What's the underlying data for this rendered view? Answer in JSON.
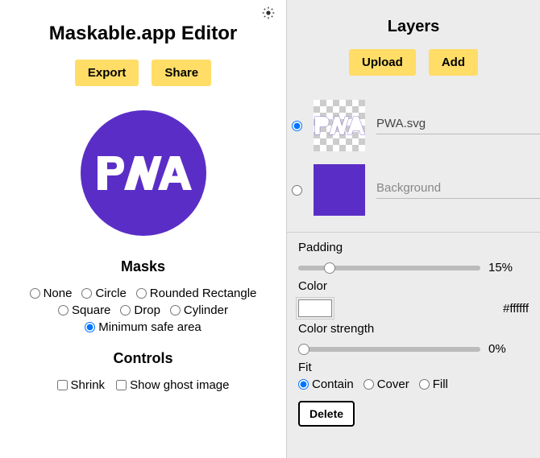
{
  "app_title": "Maskable.app Editor",
  "toolbar": {
    "export": "Export",
    "share": "Share"
  },
  "masks": {
    "heading": "Masks",
    "options": [
      "None",
      "Circle",
      "Rounded Rectangle",
      "Square",
      "Drop",
      "Cylinder",
      "Minimum safe area"
    ],
    "selected": "Minimum safe area"
  },
  "controls": {
    "heading": "Controls",
    "shrink": "Shrink",
    "ghost": "Show ghost image"
  },
  "layers_panel": {
    "heading": "Layers",
    "upload": "Upload",
    "add": "Add",
    "items": [
      {
        "name": "PWA.svg",
        "selected": true,
        "kind": "svg"
      },
      {
        "name": "Background",
        "selected": false,
        "kind": "solid"
      }
    ]
  },
  "props": {
    "padding_label": "Padding",
    "padding_value": "15%",
    "padding_slider": 15,
    "color_label": "Color",
    "color_hex": "#ffffff",
    "strength_label": "Color strength",
    "strength_value": "0%",
    "strength_slider": 0,
    "fit_label": "Fit",
    "fit_options": [
      "Contain",
      "Cover",
      "Fill"
    ],
    "fit_selected": "Contain",
    "delete": "Delete"
  },
  "preview": {
    "brand_color": "#5a2ec6"
  }
}
